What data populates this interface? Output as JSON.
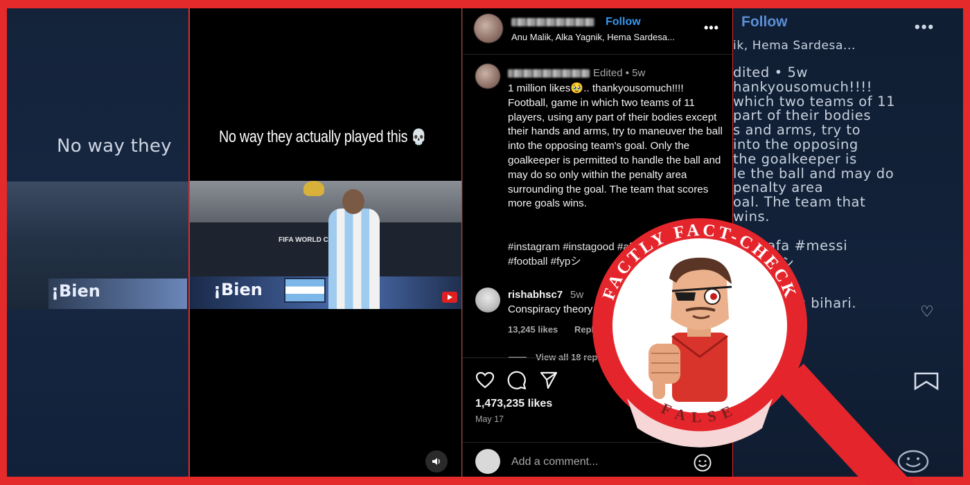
{
  "colors": {
    "frame": "#e42a2a",
    "follow_blue": "#3797f0",
    "badge_red": "#e4262c"
  },
  "left_bg": {
    "caption_text": "No way they",
    "banner_text": "¡Bien"
  },
  "video": {
    "caption": "No way they actually played this",
    "caption_emoji": "💀",
    "logo_text": "FIFA WORLD CUP Qat_ar2022",
    "banner_text": "¡Bien",
    "volume_icon": "speaker-icon"
  },
  "post": {
    "follow_label": "Follow",
    "music": "Anu Malik, Alka Yagnik, Hema Sardesa...",
    "more_icon": "•••",
    "caption_meta": "Edited • 5w",
    "caption_text": "1 million likes🥹.. thankyousomuch!!!! Football, game in which two teams of 11 players, using any part of their bodies except their hands and arms, try to maneuver the ball into the opposing team's goal. Only the goalkeeper is permitted to handle the ball and may do so only within the penalty area surrounding the goal. The team that scores more goals wins.",
    "hashtags": "#instagram #instagood #afa #messi #ronaldo #football #fypシ",
    "comment": {
      "username": "rishabhsc7",
      "time": "5w",
      "text": "Conspiracy theory :- Messi is bihari.",
      "likes": "13,245 likes",
      "reply": "Reply"
    },
    "view_all": "View all 18 replies",
    "likes_total": "1,473,235 likes",
    "date": "May 17",
    "comment_placeholder": "Add a comment..."
  },
  "right_bg": {
    "follow_label": "Follow",
    "music": "ik, Hema Sardesa...",
    "lines": [
      "dited •  5w",
      "hankyousomuch!!!!",
      "which two teams of 11",
      " part of their bodies",
      "s and arms, try to",
      " into the opposing",
      "the goalkeeper is",
      "le the ball and may do",
      " penalty area",
      "oal. The team that",
      " wins.",
      "",
      "od #afa #messi",
      "o #fypシ",
      "",
      "",
      ":– Messi is bihari."
    ]
  },
  "badge": {
    "ring_text": "FACTLY FACT-CHECK",
    "verdict": "FALSE"
  }
}
